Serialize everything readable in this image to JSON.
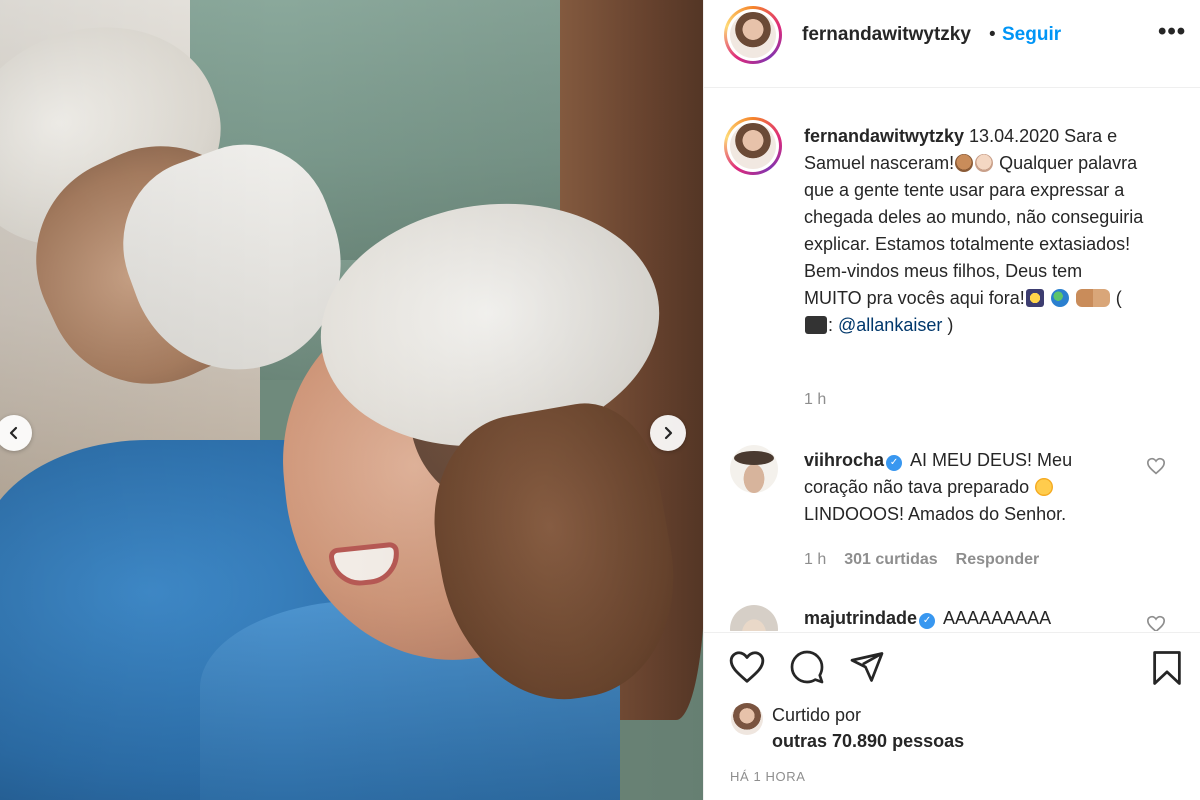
{
  "header": {
    "username": "fernandawitwytzky",
    "separator": "•",
    "follow_label": "Seguir",
    "more_label": "•••"
  },
  "caption": {
    "username": "fernandawitwytzky",
    "text_part1": " 13.04.2020 Sara e Samuel nasceram!",
    "text_part2": " Qualquer palavra que a gente tente usar para expressar a chegada deles ao mundo, não conseguiria explicar. Estamos totalmente extasiados! Bem-vindos meus filhos, Deus tem MUITO pra vocês aqui fora!",
    "text_part3": " (",
    "text_part4": ": ",
    "mention": "@allankaiser",
    "text_part5": " )",
    "time": "1 h"
  },
  "comments": [
    {
      "username": "viihrocha",
      "verified": "✓",
      "text_part1": " AI MEU DEUS! Meu coração não tava preparado ",
      "text_part2": " LINDOOOS! Amados do Senhor.",
      "time": "1 h",
      "likes": "301 curtidas",
      "reply": "Responder"
    },
    {
      "username": "majutrindade",
      "verified": "✓",
      "text": " AAAAAAAAA"
    }
  ],
  "actions": {
    "liked_prefix": "Curtido por",
    "liked_count": "outras 70.890 pessoas",
    "post_time": "HÁ 1 HORA"
  },
  "icons": {
    "prev": "chevron-left-icon",
    "next": "chevron-right-icon",
    "like": "heart-icon",
    "comment": "comment-icon",
    "share": "share-icon",
    "save": "bookmark-icon"
  },
  "colors": {
    "link_blue": "#0095f6",
    "mention_blue": "#00376b",
    "verified_blue": "#3897f0",
    "muted": "#8e8e8e",
    "text": "#262626"
  }
}
